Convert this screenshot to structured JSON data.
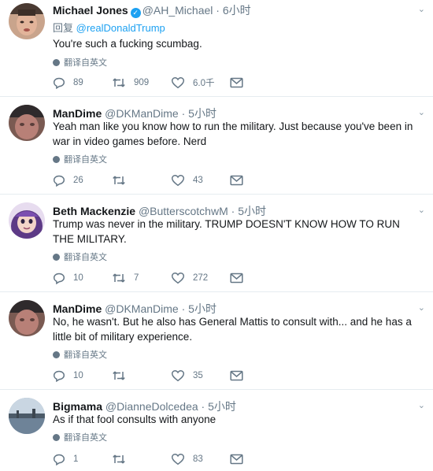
{
  "tweets": [
    {
      "name": "Michael Jones",
      "handle": "@AH_Michael",
      "time": "6小时",
      "verified": true,
      "replying_prefix": "回复",
      "replying_to": "@realDonaldTrump",
      "text": "You're such a fucking scumbag.",
      "translate": "翻译自英文",
      "replies": "89",
      "retweets": "909",
      "likes": "6.0千"
    },
    {
      "name": "ManDime",
      "handle": "@DKManDime",
      "time": "5小时",
      "verified": false,
      "text": "Yeah man like you know how to run the military. Just because you've been in war in video games before. Nerd",
      "translate": "翻译自英文",
      "replies": "26",
      "retweets": "",
      "likes": "43"
    },
    {
      "name": "Beth Mackenzie",
      "handle": "@ButterscotchwM",
      "time": "5小时",
      "verified": false,
      "text": "Trump was never in the military.  TRUMP DOESN'T KNOW HOW TO RUN THE MILITARY.",
      "translate": "翻译自英文",
      "replies": "10",
      "retweets": "7",
      "likes": "272"
    },
    {
      "name": "ManDime",
      "handle": "@DKManDime",
      "time": "5小时",
      "verified": false,
      "text": "No, he wasn't. But he also has General Mattis to consult with... and he has a little bit of military experience.",
      "translate": "翻译自英文",
      "replies": "10",
      "retweets": "",
      "likes": "35"
    },
    {
      "name": "Bigmama",
      "handle": "@DianneDolcedea",
      "time": "5小时",
      "verified": false,
      "text": "As if that fool consults with anyone",
      "translate": "翻译自英文",
      "replies": "1",
      "retweets": "",
      "likes": "83"
    }
  ],
  "icons": {
    "reply": "reply-icon",
    "retweet": "retweet-icon",
    "like": "heart-icon",
    "message": "envelope-icon",
    "caret": "chevron-down-icon",
    "globe": "globe-icon",
    "verified": "verified-badge-icon"
  },
  "colors": {
    "link": "#1da1f2",
    "meta": "#657786",
    "text": "#14171a",
    "divider": "#e6ecf0"
  }
}
